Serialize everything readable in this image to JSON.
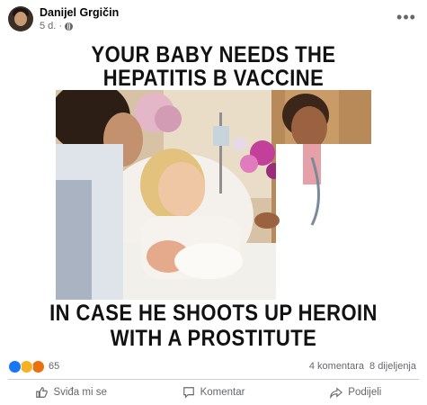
{
  "post": {
    "author": "Danijel Grgičin",
    "time": "5 d.",
    "separator": "·",
    "more_label": "•••"
  },
  "meme": {
    "top_line1": "YOUR BABY NEEDS THE",
    "top_line2": "HEPATITIS B VACCINE",
    "bottom_line1": "IN CASE HE SHOOTS UP HEROIN",
    "bottom_line2": "WITH A PROSTITUTE"
  },
  "reactions": {
    "icons": [
      "like-icon",
      "haha-icon",
      "angry-icon"
    ],
    "colors": {
      "like": "#1877f2",
      "haha": "#f7b125",
      "angry": "#e9710f"
    },
    "count": "65",
    "comments": "4 komentara",
    "shares": "8 dijeljenja"
  },
  "actions": {
    "like": "Sviđa mi se",
    "comment": "Komentar",
    "share": "Podijeli"
  }
}
